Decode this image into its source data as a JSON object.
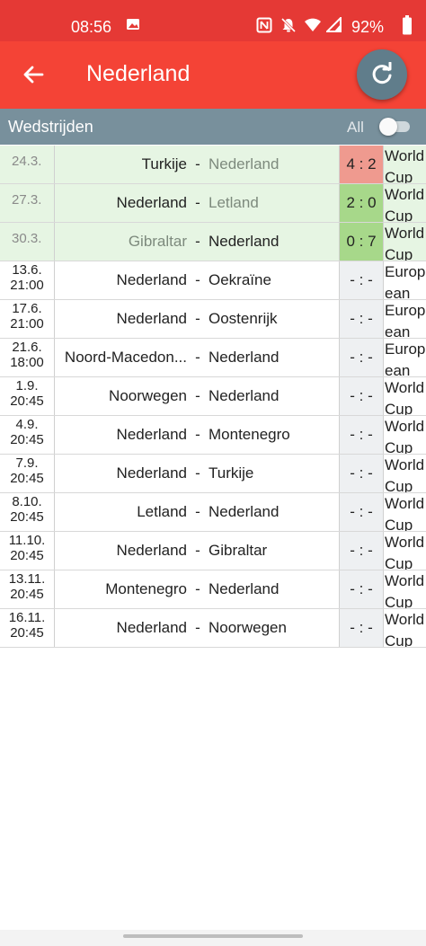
{
  "status_bar": {
    "time": "08:56",
    "battery": "92%",
    "icons": [
      "gallery-icon",
      "nfc-icon",
      "bell-off-icon",
      "wifi-icon",
      "signal-icon"
    ]
  },
  "app_bar": {
    "title": "Nederland",
    "back_icon": "arrow-back-icon",
    "refresh_icon": "refresh-icon"
  },
  "section": {
    "label": "Wedstrijden",
    "all_label": "All",
    "toggle_on": false
  },
  "colors": {
    "status_bar": "#e53935",
    "app_bar": "#f44336",
    "section_bar": "#78909c",
    "fab": "#607d8b",
    "played_row": "#e6f5e3",
    "loss_score": "#ef9a8f",
    "win_score": "#a7d88a"
  },
  "matches": [
    {
      "date": "24.3.",
      "time": "",
      "home": "Turkije",
      "away": "Nederland",
      "score": "4 : 2",
      "competition": "World Cup",
      "played": true,
      "result": "loss",
      "muted_team": "away"
    },
    {
      "date": "27.3.",
      "time": "",
      "home": "Nederland",
      "away": "Letland",
      "score": "2 : 0",
      "competition": "World Cup",
      "played": true,
      "result": "win",
      "muted_team": "away"
    },
    {
      "date": "30.3.",
      "time": "",
      "home": "Gibraltar",
      "away": "Nederland",
      "score": "0 : 7",
      "competition": "World Cup",
      "played": true,
      "result": "win",
      "muted_team": "home"
    },
    {
      "date": "13.6.",
      "time": "21:00",
      "home": "Nederland",
      "away": "Oekraïne",
      "score": "- : -",
      "competition": "European",
      "played": false,
      "result": "",
      "muted_team": ""
    },
    {
      "date": "17.6.",
      "time": "21:00",
      "home": "Nederland",
      "away": "Oostenrijk",
      "score": "- : -",
      "competition": "European",
      "played": false,
      "result": "",
      "muted_team": ""
    },
    {
      "date": "21.6.",
      "time": "18:00",
      "home": "Noord-Macedon...",
      "away": "Nederland",
      "score": "- : -",
      "competition": "European",
      "played": false,
      "result": "",
      "muted_team": ""
    },
    {
      "date": "1.9.",
      "time": "20:45",
      "home": "Noorwegen",
      "away": "Nederland",
      "score": "- : -",
      "competition": "World Cup",
      "played": false,
      "result": "",
      "muted_team": ""
    },
    {
      "date": "4.9.",
      "time": "20:45",
      "home": "Nederland",
      "away": "Montenegro",
      "score": "- : -",
      "competition": "World Cup",
      "played": false,
      "result": "",
      "muted_team": ""
    },
    {
      "date": "7.9.",
      "time": "20:45",
      "home": "Nederland",
      "away": "Turkije",
      "score": "- : -",
      "competition": "World Cup",
      "played": false,
      "result": "",
      "muted_team": ""
    },
    {
      "date": "8.10.",
      "time": "20:45",
      "home": "Letland",
      "away": "Nederland",
      "score": "- : -",
      "competition": "World Cup",
      "played": false,
      "result": "",
      "muted_team": ""
    },
    {
      "date": "11.10.",
      "time": "20:45",
      "home": "Nederland",
      "away": "Gibraltar",
      "score": "- : -",
      "competition": "World Cup",
      "played": false,
      "result": "",
      "muted_team": ""
    },
    {
      "date": "13.11.",
      "time": "20:45",
      "home": "Montenegro",
      "away": "Nederland",
      "score": "- : -",
      "competition": "World Cup",
      "played": false,
      "result": "",
      "muted_team": ""
    },
    {
      "date": "16.11.",
      "time": "20:45",
      "home": "Nederland",
      "away": "Noorwegen",
      "score": "- : -",
      "competition": "World Cup",
      "played": false,
      "result": "",
      "muted_team": ""
    }
  ]
}
